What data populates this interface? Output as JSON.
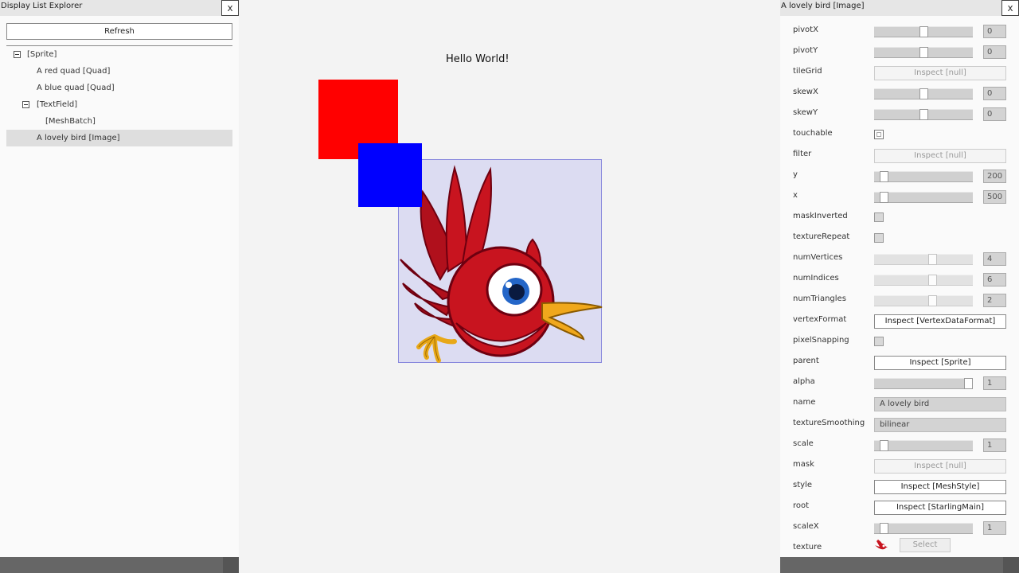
{
  "left_panel": {
    "title": "Display List Explorer",
    "close_label": "x",
    "refresh_label": "Refresh",
    "tree": [
      {
        "label": "[Sprite]",
        "depth": 0,
        "expandable": true,
        "selected": false
      },
      {
        "label": "A red quad [Quad]",
        "depth": 1,
        "expandable": false,
        "selected": false
      },
      {
        "label": "A blue quad [Quad]",
        "depth": 1,
        "expandable": false,
        "selected": false
      },
      {
        "label": "[TextField]",
        "depth": 1,
        "expandable": true,
        "selected": false
      },
      {
        "label": "[MeshBatch]",
        "depth": 2,
        "expandable": false,
        "selected": false
      },
      {
        "label": "A lovely bird [Image]",
        "depth": 1,
        "expandable": false,
        "selected": true
      }
    ]
  },
  "stage": {
    "hello_text": "Hello World!",
    "colors": {
      "red_quad": "#ff0000",
      "blue_quad": "#0000ff",
      "background": "#f3f3f3"
    }
  },
  "right_panel": {
    "title": "A lovely bird [Image]",
    "close_label": "x",
    "properties": [
      {
        "name": "pivotX",
        "type": "slider",
        "value": "0",
        "level": 0.5
      },
      {
        "name": "pivotY",
        "type": "slider",
        "value": "0",
        "level": 0.5
      },
      {
        "name": "tileGrid",
        "type": "inspect",
        "value": "Inspect [null]",
        "enabled": false
      },
      {
        "name": "skewX",
        "type": "slider",
        "value": "0",
        "level": 0.5
      },
      {
        "name": "skewY",
        "type": "slider",
        "value": "0",
        "level": 0.5
      },
      {
        "name": "touchable",
        "type": "checkbox",
        "checked": false,
        "style": "light"
      },
      {
        "name": "filter",
        "type": "inspect",
        "value": "Inspect [null]",
        "enabled": false
      },
      {
        "name": "y",
        "type": "slider",
        "value": "200",
        "level": 0.06
      },
      {
        "name": "x",
        "type": "slider",
        "value": "500",
        "level": 0.06
      },
      {
        "name": "maskInverted",
        "type": "checkbox",
        "checked": false,
        "style": "gray"
      },
      {
        "name": "textureRepeat",
        "type": "checkbox",
        "checked": false,
        "style": "gray"
      },
      {
        "name": "numVertices",
        "type": "slider",
        "value": "4",
        "level": 0.6,
        "dim": true
      },
      {
        "name": "numIndices",
        "type": "slider",
        "value": "6",
        "level": 0.6,
        "dim": true
      },
      {
        "name": "numTriangles",
        "type": "slider",
        "value": "2",
        "level": 0.6,
        "dim": true
      },
      {
        "name": "vertexFormat",
        "type": "inspect",
        "value": "Inspect [VertexDataFormat]",
        "enabled": true
      },
      {
        "name": "pixelSnapping",
        "type": "checkbox",
        "checked": false,
        "style": "gray"
      },
      {
        "name": "parent",
        "type": "inspect",
        "value": "Inspect [Sprite]",
        "enabled": true
      },
      {
        "name": "alpha",
        "type": "slider",
        "value": "1",
        "level": 1.0
      },
      {
        "name": "name",
        "type": "text",
        "value": "A lovely bird"
      },
      {
        "name": "textureSmoothing",
        "type": "text",
        "value": "bilinear"
      },
      {
        "name": "scale",
        "type": "slider",
        "value": "1",
        "level": 0.06
      },
      {
        "name": "mask",
        "type": "inspect",
        "value": "Inspect [null]",
        "enabled": false
      },
      {
        "name": "style",
        "type": "inspect",
        "value": "Inspect [MeshStyle]",
        "enabled": true
      },
      {
        "name": "root",
        "type": "inspect",
        "value": "Inspect [StarlingMain]",
        "enabled": true
      },
      {
        "name": "scaleX",
        "type": "slider",
        "value": "1",
        "level": 0.06
      },
      {
        "name": "texture",
        "type": "texture",
        "select_label": "Select"
      }
    ]
  }
}
